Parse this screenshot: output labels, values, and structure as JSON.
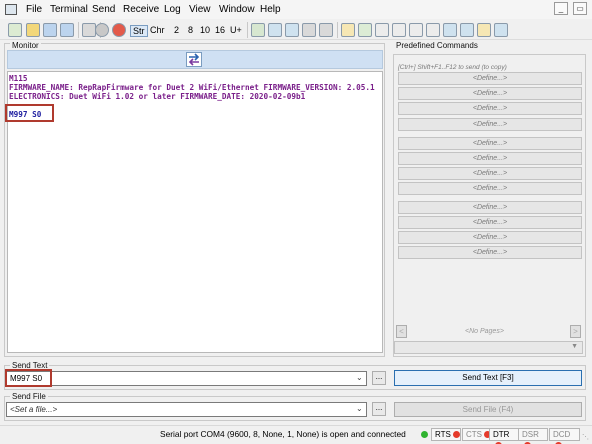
{
  "menubar": {
    "items": [
      "File",
      "Terminal",
      "Send",
      "Receive",
      "Log",
      "View",
      "Window",
      "Help"
    ]
  },
  "toolbar": {
    "text_buttons": [
      "Str",
      "Chr",
      "2",
      "8",
      "10",
      "16",
      "U+"
    ]
  },
  "monitor": {
    "title": "Monitor",
    "lines": [
      "M115",
      "FIRMWARE_NAME: RepRapFirmware for Duet 2 WiFi/Ethernet FIRMWARE_VERSION: 2.05.1",
      "ELECTRONICS: Duet WiFi 1.02 or later FIRMWARE_DATE: 2020-02-09b1",
      "M997 S0"
    ]
  },
  "predefined": {
    "title": "Predefined Commands",
    "hint": "[Ctrl+] Shift+F1..F12 to send (to copy)",
    "define_label": "<Define...>",
    "no_pages": "<No Pages>",
    "prev": "<",
    "next": ">"
  },
  "send_text": {
    "label": "Send Text",
    "value": "M997 S0",
    "button": "Send Text [F3]",
    "browse": "..."
  },
  "send_file": {
    "label": "Send File",
    "placeholder": "<Set a file...>",
    "button": "Send File (F4)",
    "browse": "..."
  },
  "status": {
    "text": "Serial port COM4 (9600, 8, None, 1, None) is open and connected",
    "indicators": [
      {
        "label": "RTS",
        "color": "#e53a2a"
      },
      {
        "label": "CTS",
        "color": "#e53a2a"
      },
      {
        "label": "DTR",
        "color": "#e53a2a"
      },
      {
        "label": "DSR",
        "color": "#e53a2a"
      },
      {
        "label": "DCD",
        "color": "#e53a2a"
      }
    ],
    "connected_color": "#2fb32f"
  },
  "colors": {
    "monitor_text": "#7a1f8a",
    "highlight_box": "#b03a2e",
    "switch_bar": "#cfe0f3"
  }
}
